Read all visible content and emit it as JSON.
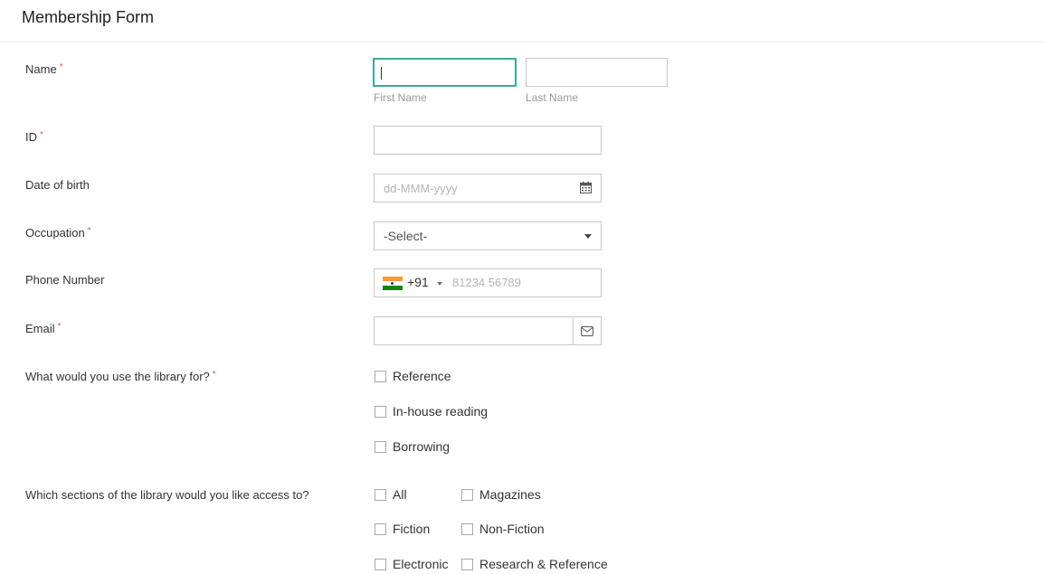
{
  "form": {
    "title": "Membership Form",
    "required_mark": "*"
  },
  "fields": {
    "name": {
      "label": "Name",
      "first_sublabel": "First Name",
      "last_sublabel": "Last Name",
      "first_value": "",
      "last_value": ""
    },
    "id": {
      "label": "ID",
      "value": ""
    },
    "dob": {
      "label": "Date of birth",
      "placeholder": "dd-MMM-yyyy",
      "icon": "calendar-icon"
    },
    "occupation": {
      "label": "Occupation",
      "selected": "-Select-",
      "icon": "chevron-down-icon"
    },
    "phone": {
      "label": "Phone Number",
      "country_code": "+91",
      "placeholder": "81234 56789",
      "flag": "india-flag-icon"
    },
    "email": {
      "label": "Email",
      "value": "",
      "icon": "envelope-icon"
    },
    "library_use": {
      "label": "What would you use the library for?",
      "options": [
        "Reference",
        "In-house reading",
        "Borrowing"
      ]
    },
    "sections": {
      "label": "Which sections of the library would you like access to?",
      "options": [
        "All",
        "Magazines",
        "Fiction",
        "Non-Fiction",
        "Electronic",
        "Research & Reference"
      ]
    }
  },
  "colors": {
    "focus_border": "#3aa99a",
    "required": "#e05b5b",
    "flag_saffron": "#ff9933",
    "flag_white": "#ffffff",
    "flag_green": "#138808"
  }
}
